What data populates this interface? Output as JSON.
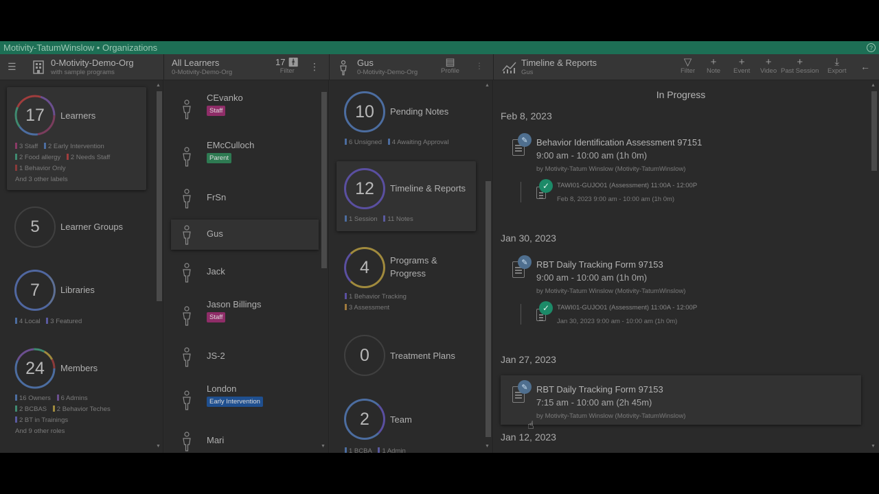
{
  "titlebar": {
    "title": "Motivity-TatumWinslow • Organizations",
    "help": "?"
  },
  "header": {
    "org": {
      "title": "0-Motivity-Demo-Org",
      "subtitle": "with sample programs"
    },
    "learners": {
      "title": "All Learners",
      "subtitle": "0-Motivity-Demo-Org",
      "count": "17",
      "filter": "Filter"
    },
    "learner": {
      "title": "Gus",
      "subtitle": "0-Motivity-Demo-Org",
      "profile": "Profile"
    },
    "timeline": {
      "title": "Timeline & Reports",
      "subtitle": "Gus"
    },
    "actions": [
      {
        "glyph": "▽",
        "label": "Filter"
      },
      {
        "glyph": "+",
        "label": "Note"
      },
      {
        "glyph": "+",
        "label": "Event"
      },
      {
        "glyph": "+",
        "label": "Video"
      },
      {
        "glyph": "+",
        "label": "Past Session"
      },
      {
        "glyph": "⤓",
        "label": "Export"
      }
    ]
  },
  "dashboard": {
    "learners": {
      "count": "17",
      "label": "Learners",
      "tags": [
        "3 Staff",
        "2 Early Intervention",
        "2 Food allergy",
        "2 Needs Staff",
        "1 Behavior Only"
      ],
      "more": "And 3 other labels"
    },
    "groups": {
      "count": "5",
      "label": "Learner Groups"
    },
    "libraries": {
      "count": "7",
      "label": "Libraries",
      "tags": [
        "4 Local",
        "3 Featured"
      ]
    },
    "members": {
      "count": "24",
      "label": "Members",
      "tags": [
        "16 Owners",
        "6 Admins",
        "2 BCBAS",
        "2 Behavior Teches",
        "2 BT in Trainings"
      ],
      "more": "And 9 other roles"
    }
  },
  "learner_list": [
    {
      "name": "CEvanko",
      "badge": "Staff",
      "badge_color": "#8f2d68"
    },
    {
      "name": "EMcCulloch",
      "badge": "Parent",
      "badge_color": "#2e7a52"
    },
    {
      "name": "FrSn",
      "badge": "",
      "badge_color": ""
    },
    {
      "name": "Gus",
      "badge": "",
      "badge_color": ""
    },
    {
      "name": "Jack",
      "badge": "",
      "badge_color": ""
    },
    {
      "name": "Jason Billings",
      "badge": "Staff",
      "badge_color": "#8f2d68"
    },
    {
      "name": "JS-2",
      "badge": "",
      "badge_color": ""
    },
    {
      "name": "London",
      "badge": "Early Intervention",
      "badge_color": "#1f4f8f"
    },
    {
      "name": "Mari",
      "badge": "",
      "badge_color": ""
    }
  ],
  "learner_cards": {
    "notes": {
      "count": "10",
      "label": "Pending Notes",
      "tags": [
        "6 Unsigned",
        "4 Awaiting Approval"
      ]
    },
    "timeline": {
      "count": "12",
      "label": "Timeline & Reports",
      "tags": [
        "1 Session",
        "11 Notes"
      ]
    },
    "programs": {
      "count": "4",
      "label1": "Programs &",
      "label2": "Progress",
      "tags": [
        "1 Behavior Tracking",
        "3 Assessment"
      ]
    },
    "plans": {
      "count": "0",
      "label": "Treatment Plans"
    },
    "team": {
      "count": "2",
      "label": "Team",
      "tags": [
        "1 BCBA",
        "1 Admin"
      ]
    }
  },
  "timeline": {
    "section": "In Progress",
    "groups": [
      {
        "date": "Feb 8, 2023",
        "title": "Behavior Identification Assessment 97151",
        "time": "9:00 am - 10:00 am (1h 0m)",
        "by": "by Motivity-Tatum Winslow (Motivity-TatumWinslow)",
        "sub_title": "TAWI01-GUJO01 (Assessment) 11:00A - 12:00P",
        "sub_time": "Feb 8, 2023 9:00 am - 10:00 am (1h 0m)"
      },
      {
        "date": "Jan 30, 2023",
        "title": "RBT Daily Tracking Form 97153",
        "time": "9:00 am - 10:00 am (1h 0m)",
        "by": "by Motivity-Tatum Winslow (Motivity-TatumWinslow)",
        "sub_title": "TAWI01-GUJO01 (Assessment) 11:00A - 12:00P",
        "sub_time": "Jan 30, 2023 9:00 am - 10:00 am (1h 0m)"
      },
      {
        "date": "Jan 27, 2023",
        "title": "RBT Daily Tracking Form 97153",
        "time": "7:15 am - 10:00 am (2h 45m)",
        "by": "by Motivity-Tatum Winslow (Motivity-TatumWinslow)"
      }
    ],
    "next_date": "Jan 12, 2023"
  }
}
